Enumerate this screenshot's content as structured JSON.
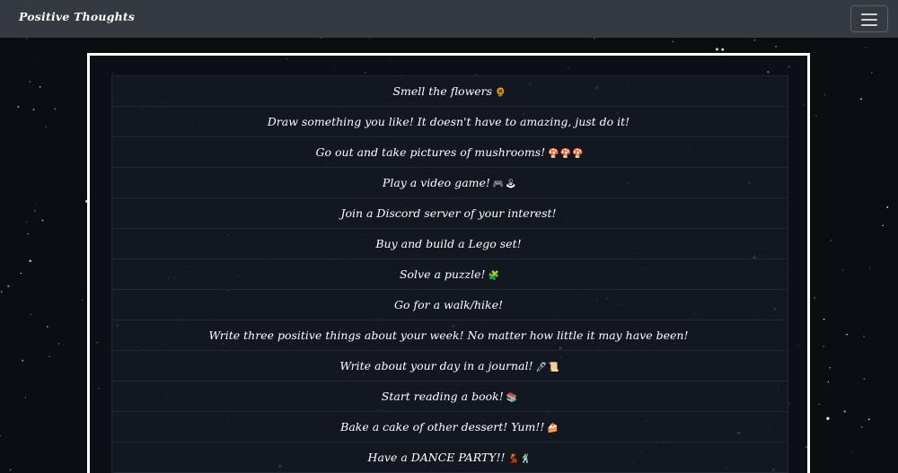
{
  "navbar": {
    "brand": "Positive Thoughts",
    "toggle_icon": "hamburger-menu-icon"
  },
  "items": [
    {
      "text": "Smell the flowers",
      "emoji": "🌻"
    },
    {
      "text": "Draw something you like! It doesn't have to amazing, just do it!",
      "emoji": ""
    },
    {
      "text": "Go out and take pictures of mushrooms!",
      "emoji": "🍄🍄🍄"
    },
    {
      "text": "Play a video game!",
      "emoji": "🎮🕹"
    },
    {
      "text": "Join a Discord server of your interest!",
      "emoji": ""
    },
    {
      "text": "Buy and build a Lego set!",
      "emoji": ""
    },
    {
      "text": "Solve a puzzle!",
      "emoji": "🧩"
    },
    {
      "text": "Go for a walk/hike!",
      "emoji": ""
    },
    {
      "text": "Write three positive things about your week! No matter how little it may have been!",
      "emoji": ""
    },
    {
      "text": "Write about your day in a journal!",
      "emoji": "🖊📜"
    },
    {
      "text": "Start reading a book!",
      "emoji": "📚"
    },
    {
      "text": "Bake a cake of other dessert! Yum!!",
      "emoji": "🍰"
    },
    {
      "text": "Have a DANCE PARTY!!",
      "emoji": "💃🕺"
    }
  ],
  "colors": {
    "background": "#0a0d12",
    "navbar": "#343a40",
    "panel_border": "#ffffff",
    "text": "#ffffff"
  }
}
